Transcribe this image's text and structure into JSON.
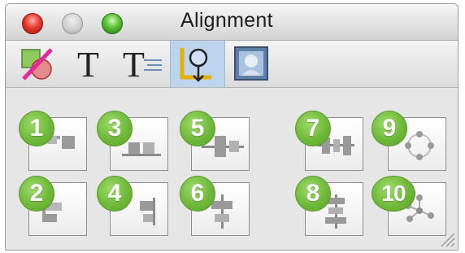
{
  "window": {
    "title": "Alignment"
  },
  "toolbar": {
    "tools": [
      {
        "icon": "fill-stroke-icon"
      },
      {
        "icon": "text-icon",
        "glyph": "T"
      },
      {
        "icon": "text-wrap-icon",
        "glyph": "T"
      },
      {
        "icon": "alignment-icon",
        "selected": true
      },
      {
        "icon": "image-icon"
      }
    ]
  },
  "alignment": {
    "buttons": [
      {
        "number": "1",
        "icon": "align-top-icon"
      },
      {
        "number": "2",
        "icon": "align-left-icon"
      },
      {
        "number": "3",
        "icon": "align-bottom-icon"
      },
      {
        "number": "4",
        "icon": "align-right-icon"
      },
      {
        "number": "5",
        "icon": "align-vertical-center-icon"
      },
      {
        "number": "6",
        "icon": "align-horizontal-center-icon"
      },
      {
        "number": "7",
        "icon": "distribute-horizontal-icon"
      },
      {
        "number": "8",
        "icon": "distribute-vertical-icon"
      },
      {
        "number": "9",
        "icon": "distribute-circle-icon"
      },
      {
        "number": "10",
        "icon": "distribute-radial-icon"
      }
    ]
  },
  "colors": {
    "badge_green": "#6fb93a",
    "selected_tool": "#bcd4ee",
    "close": "#e83a2f",
    "zoom": "#57c233"
  }
}
